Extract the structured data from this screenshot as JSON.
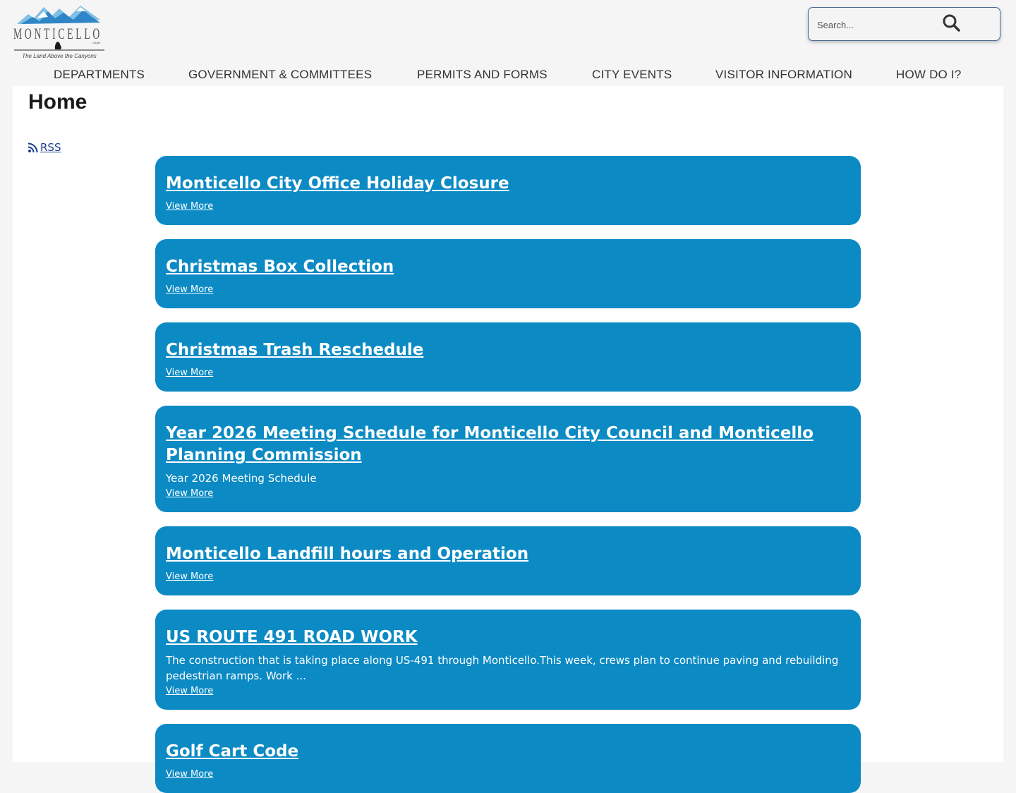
{
  "logo": {
    "wordmark": "MONTICELLO",
    "state": "UTAH",
    "tagline": "The Land Above the Canyons"
  },
  "search": {
    "placeholder": "Search..."
  },
  "nav": [
    {
      "label": "DEPARTMENTS"
    },
    {
      "label": "GOVERNMENT & COMMITTEES"
    },
    {
      "label": "PERMITS AND FORMS"
    },
    {
      "label": "CITY EVENTS"
    },
    {
      "label": "VISITOR INFORMATION"
    },
    {
      "label": "HOW DO I?"
    }
  ],
  "page": {
    "title": "Home",
    "rss_label": "RSS"
  },
  "news": [
    {
      "title": "Monticello City Office Holiday Closure",
      "description": "",
      "more": "View More"
    },
    {
      "title": "Christmas Box Collection",
      "description": "",
      "more": "View More"
    },
    {
      "title": "Christmas Trash Reschedule",
      "description": "",
      "more": "View More"
    },
    {
      "title": "Year 2026 Meeting Schedule for Monticello City Council and Monticello Planning Commission",
      "description": "Year 2026 Meeting Schedule",
      "more": "View More"
    },
    {
      "title": "Monticello Landfill hours and Operation",
      "description": "",
      "more": "View More"
    },
    {
      "title": "US ROUTE 491 ROAD WORK",
      "description": "The construction that is taking place along US-491 through Monticello.This week, crews plan to continue paving and rebuilding pedestrian ramps. Work ...",
      "more": "View More"
    },
    {
      "title": "Golf Cart Code",
      "description": "",
      "more": "View More"
    }
  ],
  "colors": {
    "card": "#0b8ac4",
    "page_bg": "#f5f5f5",
    "link": "#1a3d8f",
    "text": "#333333"
  }
}
